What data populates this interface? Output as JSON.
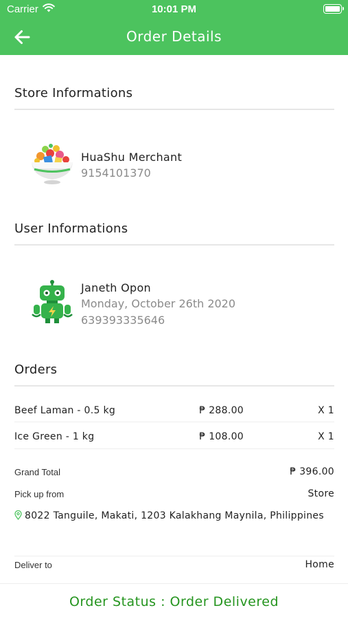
{
  "status_bar": {
    "carrier": "Carrier",
    "time": "10:01 PM"
  },
  "header": {
    "title": "Order Details"
  },
  "store": {
    "section_title": "Store Informations",
    "name": "HuaShu Merchant",
    "phone": "9154101370"
  },
  "user": {
    "section_title": "User Informations",
    "name": "Janeth Opon",
    "date": "Monday, October 26th 2020",
    "phone": "639393335646"
  },
  "orders": {
    "section_title": "Orders",
    "items": [
      {
        "name": "Beef Laman - 0.5 kg",
        "price": "₱ 288.00",
        "qty": "X 1"
      },
      {
        "name": "Ice Green - 1 kg",
        "price": "₱ 108.00",
        "qty": "X 1"
      }
    ]
  },
  "summary": {
    "grand_total_label": "Grand Total",
    "grand_total_value": "₱ 396.00",
    "pickup_label": "Pick up from",
    "pickup_value": "Store",
    "address": "8022 Tanguile, Makati, 1203 Kalakhang Maynila, Philippines",
    "deliver_label": "Deliver to",
    "deliver_value": "Home"
  },
  "footer": {
    "status": "Order Status : Order Delivered"
  },
  "colors": {
    "brand_green": "#4cc35e",
    "status_green": "#24941e",
    "muted_text": "#8b8b8b"
  },
  "icons": {
    "back": "arrow-left-icon",
    "wifi": "wifi-icon",
    "battery": "battery-icon",
    "store_avatar": "fruit-bowl-icon",
    "user_avatar": "robot-icon",
    "location": "map-pin-icon"
  }
}
